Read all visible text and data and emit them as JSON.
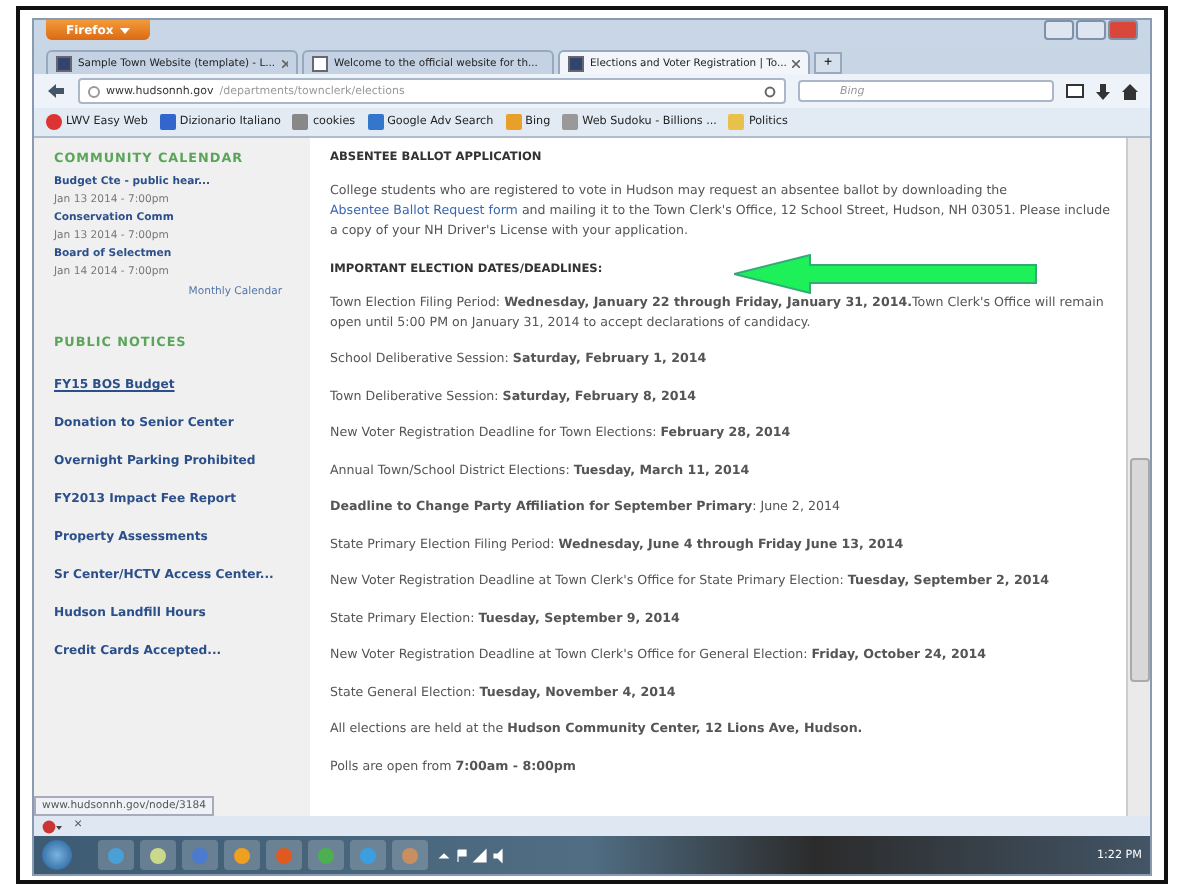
{
  "browser": {
    "menu_button": "Firefox",
    "tabs": [
      {
        "label": "Sample Town Website (template) - L...",
        "selected": false,
        "kind": "page"
      },
      {
        "label": "Welcome to the official website for th...",
        "selected": false,
        "kind": "blank"
      },
      {
        "label": "Elections and Voter Registration | To...",
        "selected": true,
        "kind": "page"
      }
    ],
    "new_tab": "+",
    "address": {
      "host": "www.hudsonnh.gov",
      "path": "/departments/townclerk/elections"
    },
    "search": {
      "placeholder": "Bing"
    },
    "bookmarks": [
      "LWV Easy Web",
      "Dizionario Italiano",
      "cookies",
      "Google Adv Search",
      "Bing",
      "Web Sudoku - Billions ...",
      "Politics"
    ]
  },
  "sidebar": {
    "calendar": {
      "heading": "COMMUNITY CALENDAR",
      "events": [
        {
          "title": "Budget Cte - public hear...",
          "date": "Jan 13 2014 - 7:00pm"
        },
        {
          "title": "Conservation Comm",
          "date": "Jan 13 2014 - 7:00pm"
        },
        {
          "title": "Board of Selectmen",
          "date": "Jan 14 2014 - 7:00pm"
        }
      ],
      "link": "Monthly Calendar"
    },
    "notices": {
      "heading": "PUBLIC NOTICES",
      "items": [
        {
          "label": "FY15 BOS Budget",
          "hovered": true
        },
        {
          "label": "Donation to Senior Center",
          "hovered": false
        },
        {
          "label": "Overnight Parking Prohibited",
          "hovered": false
        },
        {
          "label": "FY2013 Impact Fee Report",
          "hovered": false
        },
        {
          "label": "Property Assessments",
          "hovered": false
        },
        {
          "label": "Sr Center/HCTV Access Center...",
          "hovered": false
        },
        {
          "label": "Hudson Landfill Hours",
          "hovered": false
        },
        {
          "label": "Credit Cards Accepted...",
          "hovered": false
        }
      ]
    }
  },
  "article": {
    "heading": "ABSENTEE BALLOT APPLICATION",
    "intro": {
      "before": "College students who are registered to vote in Hudson may request an absentee ballot by downloading the ",
      "link": "Absentee Ballot Request form",
      "after": " and mailing it to the Town Clerk's Office, 12 School Street, Hudson, NH 03051. Please include a copy of your NH Driver's License with your application."
    },
    "subheading": "IMPORTANT ELECTION DATES/DEADLINES:",
    "dates": [
      "Town Election Filing Period: **Wednesday, January 22 through Friday, January 31, 2014.**Town Clerk's Office will remain open until 5:00 PM on January 31, 2014 to accept declarations of candidacy.",
      "School Deliberative Session: **Saturday, February 1, 2014**",
      "Town Deliberative Session: **Saturday, February 8, 2014**",
      "New Voter Registration Deadline for Town Elections: **February 28, 2014**",
      "Annual Town/School District Elections: **Tuesday, March 11, 2014**",
      "**Deadline to Change Party Affiliation for September Primary**: June 2, 2014",
      "State Primary Election Filing Period: **Wednesday, June 4 through Friday June 13, 2014**",
      "New Voter Registration Deadline at Town Clerk's Office for State Primary Election: **Tuesday, September 2, 2014**",
      "State Primary Election: **Tuesday, September 9, 2014**",
      "New Voter Registration Deadline at Town Clerk's Office for General Election: **Friday, October 24, 2014**",
      "State General Election: **Tuesday, November 4, 2014**",
      "All elections are held at the **Hudson Community Center, 12 Lions Ave, Hudson.**",
      "Polls are open from **7:00am - 8:00pm**"
    ]
  },
  "status_url": "www.hudsonnh.gov/node/3184",
  "addon_bar_close": "×",
  "clock": "1:22 PM"
}
